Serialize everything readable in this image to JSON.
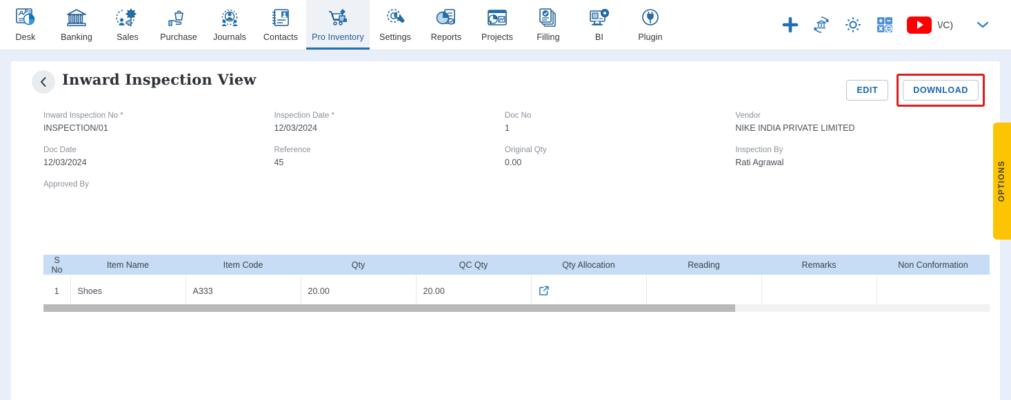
{
  "nav": {
    "items": [
      {
        "label": "Desk",
        "icon": "desk-dashboard-icon",
        "active": false
      },
      {
        "label": "Banking",
        "icon": "bank-building-icon",
        "active": false
      },
      {
        "label": "Sales",
        "icon": "sales-megaphone-icon",
        "active": false
      },
      {
        "label": "Purchase",
        "icon": "purchase-hand-bag-icon",
        "active": false
      },
      {
        "label": "Journals",
        "icon": "journals-gear-people-icon",
        "active": false
      },
      {
        "label": "Contacts",
        "icon": "contacts-book-icon",
        "active": false
      },
      {
        "label": "Pro Inventory",
        "icon": "inventory-cart-icon",
        "active": true
      },
      {
        "label": "Settings",
        "icon": "settings-gear-wrench-icon",
        "active": false
      },
      {
        "label": "Reports",
        "icon": "reports-piechart-icon",
        "active": false
      },
      {
        "label": "Projects",
        "icon": "projects-window-icon",
        "active": false
      },
      {
        "label": "Filling",
        "icon": "filling-documents-icon",
        "active": false
      },
      {
        "label": "BI",
        "icon": "bi-monitor-gear-icon",
        "active": false
      },
      {
        "label": "Plugin",
        "icon": "plugin-plug-icon",
        "active": false
      }
    ],
    "right": {
      "add_icon": "plus-icon",
      "bank_sync_icon": "bank-sync-icon",
      "settings_icon": "gear-icon",
      "calculator_icon": "calculator-icon",
      "youtube_icon": "youtube-play-icon",
      "user_label": "\\/C)",
      "chevron_icon": "chevron-down-icon"
    }
  },
  "page": {
    "back_icon": "chevron-left-icon",
    "title": "Inward Inspection View",
    "edit_label": "EDIT",
    "download_label": "DOWNLOAD",
    "annotation_color": "#e01b1b",
    "options_tab_label": "OPTIONS",
    "options_tab_color": "#fdc403"
  },
  "fields": [
    [
      {
        "label": "Inward Inspection No *",
        "value": "INSPECTION/01"
      },
      {
        "label": "Inspection Date *",
        "value": "12/03/2024"
      },
      {
        "label": "Doc No",
        "value": "1"
      },
      {
        "label": "Vendor",
        "value": "NIKE INDIA PRIVATE LIMITED"
      }
    ],
    [
      {
        "label": "Doc Date",
        "value": "12/03/2024"
      },
      {
        "label": "Reference",
        "value": "45"
      },
      {
        "label": "Original Qty",
        "value": "0.00"
      },
      {
        "label": "Inspection By",
        "value": "Rati Agrawal"
      }
    ],
    [
      {
        "label": "Approved By",
        "value": ""
      }
    ]
  ],
  "table": {
    "columns": [
      "S No",
      "Item Name",
      "Item Code",
      "Qty",
      "QC Qty",
      "Qty Allocation",
      "Reading",
      "Remarks",
      "Non Conformation"
    ],
    "rows": [
      {
        "s_no": "1",
        "item_name": "Shoes",
        "item_code": "A333",
        "qty": "20.00",
        "qc_qty": "20.00",
        "qty_allocation_icon": "external-link-icon",
        "reading": "",
        "remarks": "",
        "non_conformation": ""
      }
    ],
    "header_bg": "#c6ddf5",
    "scrollbar": {
      "thumb_color": "#b9b9b9",
      "track_color": "#f2f2f2"
    }
  }
}
